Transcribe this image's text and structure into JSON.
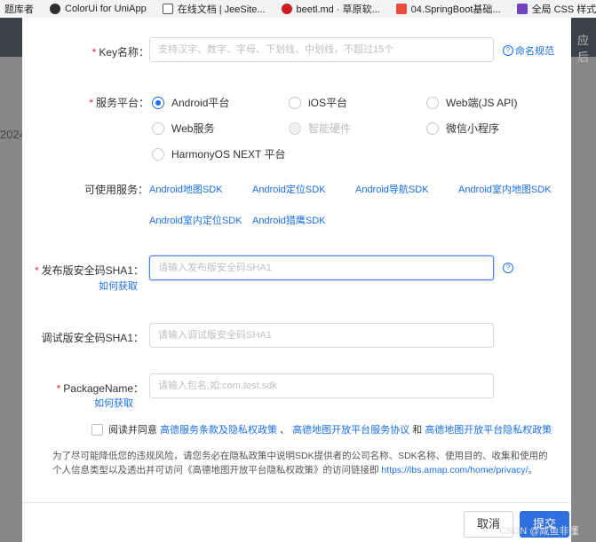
{
  "bookmarks": [
    {
      "label": "题库者",
      "color": "#e94235"
    },
    {
      "label": "ColorUi for UniApp",
      "color": "#2d2d2d"
    },
    {
      "label": "在线文档 | JeeSite...",
      "color": "#4a4a4a"
    },
    {
      "label": "beetl.md · 草原软...",
      "color": "#c71d23"
    },
    {
      "label": "04.SpringBoot基础...",
      "color": "#e94b3c"
    },
    {
      "label": "全局 CSS 样式",
      "color": "#6f42c1"
    }
  ],
  "background": {
    "left_text": "2024",
    "right_text": "应后"
  },
  "form": {
    "key_name": {
      "label": "Key名称：",
      "placeholder": "支持汉字、数字、字母、下划线、中划线，不超过15个",
      "help": "命名规范"
    },
    "platform": {
      "label": "服务平台：",
      "options": [
        {
          "label": "Android平台",
          "checked": true,
          "disabled": false
        },
        {
          "label": "iOS平台",
          "checked": false,
          "disabled": false
        },
        {
          "label": "Web端(JS API)",
          "checked": false,
          "disabled": false
        },
        {
          "label": "Web服务",
          "checked": false,
          "disabled": false
        },
        {
          "label": "智能硬件",
          "checked": false,
          "disabled": true
        },
        {
          "label": "微信小程序",
          "checked": false,
          "disabled": false
        },
        {
          "label": "HarmonyOS NEXT 平台",
          "checked": false,
          "disabled": false
        }
      ]
    },
    "services": {
      "label": "可使用服务：",
      "items": [
        "Android地图SDK",
        "Android定位SDK",
        "Android导航SDK",
        "Android室内地图SDK",
        "Android室内定位SDK",
        "Android猎鹰SDK"
      ]
    },
    "release_sha1": {
      "label": "发布版安全码SHA1：",
      "placeholder": "请输入发布版安全码SHA1",
      "help": "如何获取"
    },
    "debug_sha1": {
      "label": "调试版安全码SHA1：",
      "placeholder": "请输入调试版安全码SHA1"
    },
    "package_name": {
      "label": "PackageName：",
      "placeholder": "请输入包名,如:com.test.sdk",
      "help": "如何获取"
    },
    "agreement": {
      "prefix": "阅读并同意",
      "link1": "高德服务条款及隐私权政策",
      "sep1": "、",
      "link2": "高德地图开放平台服务协议",
      "sep2": "和",
      "link3": "高德地图开放平台隐私权政策"
    },
    "notice": {
      "text": "为了尽可能降低您的违规风险，请您务必在隐私政策中说明SDK提供者的公司名称、SDK名称、使用目的、收集和使用的个人信息类型以及透出并可访问《高德地图开放平台隐私权政策》的访问链接即",
      "url": "https://lbs.amap.com/home/privacy/",
      "end": "。"
    }
  },
  "footer": {
    "cancel": "取消",
    "submit": "提交"
  },
  "watermark": "CSDN @咸鱼非懂"
}
